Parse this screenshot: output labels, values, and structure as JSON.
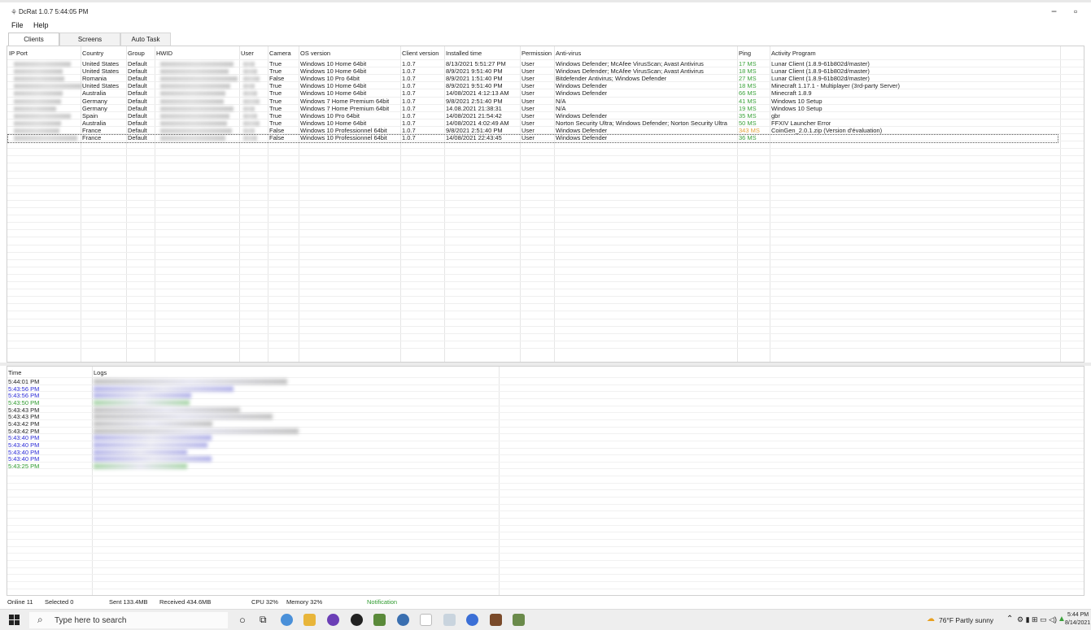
{
  "window": {
    "app_name": "DcRat",
    "version": "1.0.7",
    "clock": "5:44:05 PM",
    "minimize_glyph": "−",
    "restore_glyph": "▫"
  },
  "menu": [
    "File",
    "Help"
  ],
  "tabs": [
    {
      "label": "Clients",
      "active": true
    },
    {
      "label": "Screens",
      "active": false
    },
    {
      "label": "Auto Task",
      "active": false
    }
  ],
  "clients_table": {
    "columns": [
      "IP Port",
      "Country",
      "Group",
      "HWID",
      "User",
      "Camera",
      "OS version",
      "Client version",
      "Installed time",
      "Permission",
      "Anti-virus",
      "Ping",
      "Activity Program"
    ],
    "rows": [
      {
        "country": "United States",
        "group": "Default",
        "camera": "True",
        "os": "Windows 10 Home 64bit",
        "client_version": "1.0.7",
        "installed": "8/13/2021 5:51:27 PM",
        "permission": "User",
        "antivirus": "Windows Defender; McAfee VirusScan; Avast Antivirus",
        "ping": "17 MS",
        "activity": "Lunar Client (1.8.9-61b802d/master)"
      },
      {
        "country": "United States",
        "group": "Default",
        "camera": "True",
        "os": "Windows 10 Home 64bit",
        "client_version": "1.0.7",
        "installed": "8/9/2021 9:51:40 PM",
        "permission": "User",
        "antivirus": "Windows Defender; McAfee VirusScan; Avast Antivirus",
        "ping": "18 MS",
        "activity": "Lunar Client (1.8.9-61b802d/master)"
      },
      {
        "country": "Romania",
        "group": "Default",
        "camera": "False",
        "os": "Windows 10 Pro 64bit",
        "client_version": "1.0.7",
        "installed": "8/9/2021 1:51:40 PM",
        "permission": "User",
        "antivirus": "Bitdefender Antivirus; Windows Defender",
        "ping": "27 MS",
        "activity": "Lunar Client (1.8.9-61b802d/master)"
      },
      {
        "country": "United States",
        "group": "Default",
        "camera": "True",
        "os": "Windows 10 Home 64bit",
        "client_version": "1.0.7",
        "installed": "8/9/2021 9:51:40 PM",
        "permission": "User",
        "antivirus": "Windows Defender",
        "ping": "18 MS",
        "activity": "Minecraft 1.17.1 - Multiplayer (3rd-party Server)"
      },
      {
        "country": "Australia",
        "group": "Default",
        "camera": "True",
        "os": "Windows 10 Home 64bit",
        "client_version": "1.0.7",
        "installed": "14/08/2021 4:12:13 AM",
        "permission": "User",
        "antivirus": "Windows Defender",
        "ping": "66 MS",
        "activity": "Minecraft 1.8.9"
      },
      {
        "country": "Germany",
        "group": "Default",
        "camera": "True",
        "os": "Windows 7 Home Premium 64bit",
        "client_version": "1.0.7",
        "installed": "9/8/2021 2:51:40 PM",
        "permission": "User",
        "antivirus": "N/A",
        "ping": "41 MS",
        "activity": "Windows 10 Setup"
      },
      {
        "country": "Germany",
        "group": "Default",
        "camera": "True",
        "os": "Windows 7 Home Premium 64bit",
        "client_version": "1.0.7",
        "installed": "14.08.2021 21:38:31",
        "permission": "User",
        "antivirus": "N/A",
        "ping": "19 MS",
        "activity": "Windows 10 Setup"
      },
      {
        "country": "Spain",
        "group": "Default",
        "camera": "True",
        "os": "Windows 10 Pro 64bit",
        "client_version": "1.0.7",
        "installed": "14/08/2021 21:54:42",
        "permission": "User",
        "antivirus": "Windows Defender",
        "ping": "35 MS",
        "activity": "gbr"
      },
      {
        "country": "Australia",
        "group": "Default",
        "camera": "True",
        "os": "Windows 10 Home 64bit",
        "client_version": "1.0.7",
        "installed": "14/08/2021 4:02:49 AM",
        "permission": "User",
        "antivirus": "Norton Security Ultra; Windows Defender; Norton Security Ultra",
        "ping": "50 MS",
        "activity": "FFXIV Launcher Error"
      },
      {
        "country": "France",
        "group": "Default",
        "camera": "False",
        "os": "Windows 10 Professionnel 64bit",
        "client_version": "1.0.7",
        "installed": "9/8/2021 2:51:40 PM",
        "permission": "User",
        "antivirus": "Windows Defender",
        "ping": "343 MS",
        "activity": "CoinGen_2.0.1.zip (Version d'évaluation)"
      },
      {
        "country": "France",
        "group": "Default",
        "camera": "False",
        "os": "Windows 10 Professionnel 64bit",
        "client_version": "1.0.7",
        "installed": "14/08/2021 22:43:45",
        "permission": "User",
        "antivirus": "Windows Defender",
        "ping": "36 MS",
        "activity": ""
      }
    ]
  },
  "logs_table": {
    "columns": [
      "Time",
      "Logs"
    ],
    "rows": [
      {
        "time": "5:44:01 PM",
        "level": "info"
      },
      {
        "time": "5:43:56 PM",
        "level": "notice"
      },
      {
        "time": "5:43:56 PM",
        "level": "notice"
      },
      {
        "time": "5:43:50 PM",
        "level": "success"
      },
      {
        "time": "5:43:43 PM",
        "level": "info"
      },
      {
        "time": "5:43:43 PM",
        "level": "info"
      },
      {
        "time": "5:43:42 PM",
        "level": "info"
      },
      {
        "time": "5:43:42 PM",
        "level": "info"
      },
      {
        "time": "5:43:40 PM",
        "level": "notice"
      },
      {
        "time": "5:43:40 PM",
        "level": "notice"
      },
      {
        "time": "5:43:40 PM",
        "level": "notice"
      },
      {
        "time": "5:43:40 PM",
        "level": "notice"
      },
      {
        "time": "5:43:25 PM",
        "level": "success"
      }
    ]
  },
  "statusbar": {
    "online": "Online 11",
    "selected": "Selected 0",
    "sent": "Sent 133.4MB",
    "received": "Received 434.6MB",
    "cpu": "CPU 32%",
    "memory": "Memory 32%",
    "notification": "Notification"
  },
  "taskbar": {
    "search_placeholder": "Type here to search",
    "weather": "76°F  Partly sunny",
    "time": "5:44 PM",
    "date": "8/14/2021"
  },
  "colors": {
    "ping_good": "#3aa13a",
    "ping_bad": "#e3a23a",
    "log_info": "#222222",
    "log_notice": "#2b2bd6",
    "log_success": "#2e9a2e",
    "notification": "#2e9a2e"
  }
}
